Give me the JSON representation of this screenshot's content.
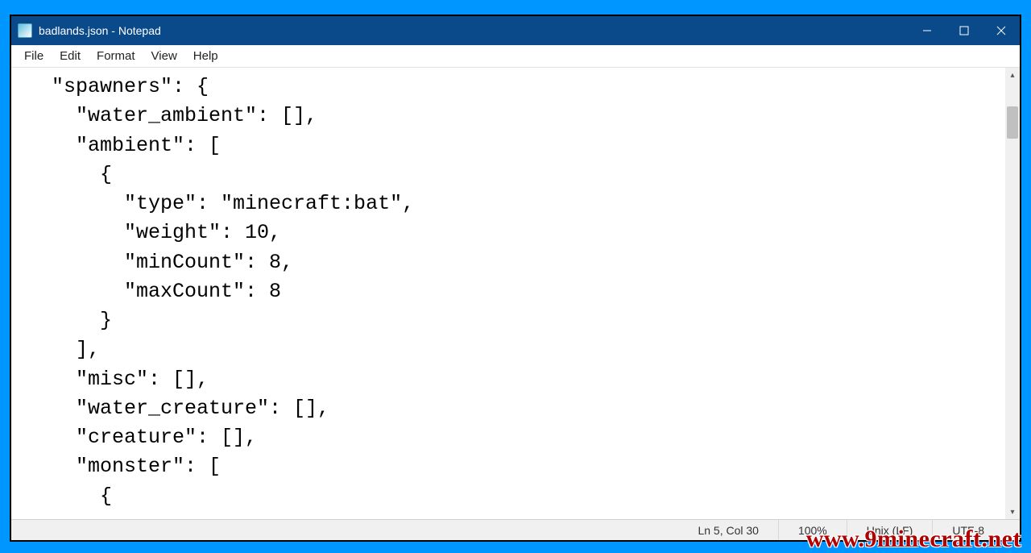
{
  "window": {
    "title": "badlands.json - Notepad"
  },
  "menu": {
    "file": "File",
    "edit": "Edit",
    "format": "Format",
    "view": "View",
    "help": "Help"
  },
  "editor": {
    "content": "\"spawners\": {\n  \"water_ambient\": [],\n  \"ambient\": [\n    {\n      \"type\": \"minecraft:bat\",\n      \"weight\": 10,\n      \"minCount\": 8,\n      \"maxCount\": 8\n    }\n  ],\n  \"misc\": [],\n  \"water_creature\": [],\n  \"creature\": [],\n  \"monster\": [\n    {"
  },
  "statusbar": {
    "position": "Ln 5, Col 30",
    "zoom": "100%",
    "line_ending": "Unix (LF)",
    "encoding": "UTF-8"
  },
  "watermark": "www.9minecraft.net"
}
